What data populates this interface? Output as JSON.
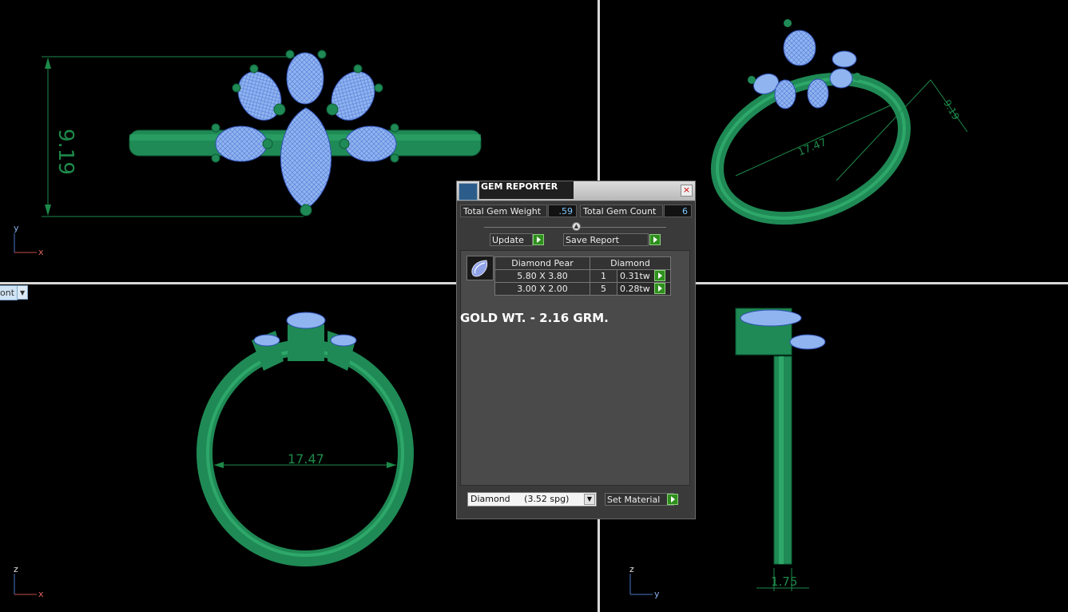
{
  "viewports": {
    "top": {
      "dimension": "9.19",
      "axis_up": "y",
      "axis_right": "x"
    },
    "perspective": {
      "dimension_width": "17.47",
      "dimension_height": "9.19"
    },
    "front": {
      "dimension": "17.47",
      "axis_up": "z",
      "axis_right": "x",
      "view_menu_label": "ont"
    },
    "right": {
      "dimension": "1.75",
      "axis_up": "z",
      "axis_right": "y"
    }
  },
  "colors": {
    "metal": "#1f8a55",
    "metal_dark": "#0d5a35",
    "gem": "#8fb4f0",
    "gem_wire": "#3b5fc8",
    "dimension": "#1d8a4a",
    "panel_bg": "#3a3a3a",
    "go_button": "#2f8f1e",
    "value_text": "#7ec8ff"
  },
  "gem_reporter": {
    "title": "GEM REPORTER",
    "total_weight_label": "Total Gem Weight",
    "total_weight_value": ".59",
    "total_count_label": "Total Gem Count",
    "total_count_value": "6",
    "update_label": "Update",
    "save_report_label": "Save Report",
    "table": {
      "headers": [
        "Diamond Pear",
        "Diamond"
      ],
      "rows": [
        {
          "size": "5.80 X 3.80",
          "count": "1",
          "weight": "0.31tw"
        },
        {
          "size": "3.00 X 2.00",
          "count": "5",
          "weight": "0.28tw"
        }
      ]
    },
    "note": "GOLD WT. - 2.16 GRM.",
    "material_option": "Diamond     (3.52 spg)",
    "set_material_label": "Set Material"
  }
}
